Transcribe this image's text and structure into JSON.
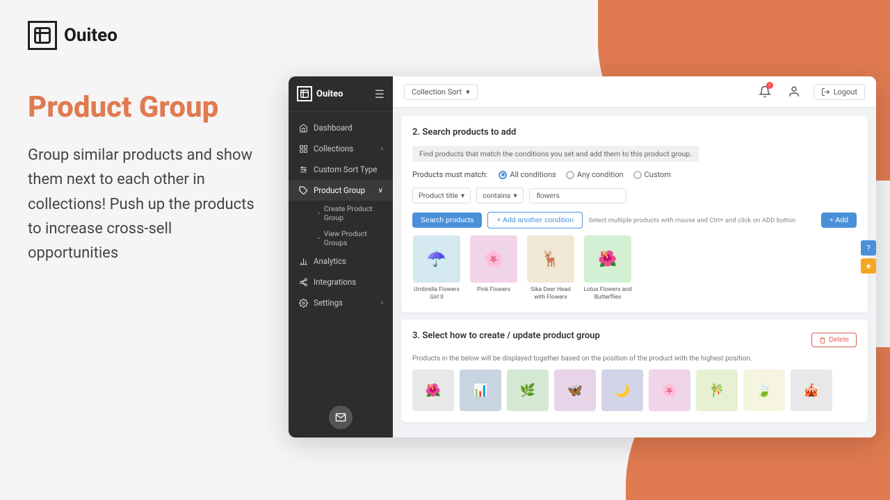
{
  "app": {
    "logo_text": "Ouiteo",
    "logo_icon": "bracket-icon"
  },
  "left_panel": {
    "title": "Product Group",
    "description": "Group similar products and show them next to each other in collections! Push up the products to increase cross-sell opportunities"
  },
  "sidebar": {
    "logo_text": "Ouiteo",
    "nav_items": [
      {
        "id": "dashboard",
        "label": "Dashboard",
        "icon": "home-icon",
        "active": false,
        "has_arrow": false
      },
      {
        "id": "collections",
        "label": "Collections",
        "icon": "grid-icon",
        "active": false,
        "has_arrow": true
      },
      {
        "id": "custom-sort-type",
        "label": "Custom Sort Type",
        "icon": "sliders-icon",
        "active": false,
        "has_arrow": false
      },
      {
        "id": "product-group",
        "label": "Product Group",
        "icon": "tag-icon",
        "active": true,
        "has_arrow": true
      }
    ],
    "sub_items": [
      {
        "label": "Create Product Group",
        "active": false
      },
      {
        "label": "View Product Groups",
        "active": false
      }
    ],
    "bottom_items": [
      {
        "id": "analytics",
        "label": "Analytics",
        "icon": "chart-icon",
        "active": false
      },
      {
        "id": "integrations",
        "label": "Integrations",
        "icon": "plug-icon",
        "active": false
      },
      {
        "id": "settings",
        "label": "Settings",
        "icon": "settings-icon",
        "active": false,
        "has_arrow": true
      }
    ]
  },
  "topbar": {
    "collection_sort_label": "Collection Sort",
    "dropdown_arrow": "▾",
    "notifications_badge": "1",
    "logout_label": "Logout"
  },
  "section2": {
    "title": "2. Search products to add",
    "hint": "Find products that match the conditions you set and add them to this product group.",
    "products_must_match_label": "Products must match:",
    "match_options": [
      "All conditions",
      "Any condition",
      "Custom"
    ],
    "active_match": "All conditions",
    "condition_field": "Product title",
    "condition_operator": "contains",
    "condition_value": "flowers",
    "search_btn": "Search products",
    "add_condition_btn": "+ Add another condition",
    "select_hint": "Select multiple products with mouse and Ctrl+ and click on ADD button",
    "add_btn": "+ Add",
    "products": [
      {
        "name": "Umbrella Flowers Girl II",
        "emoji": "☂️"
      },
      {
        "name": "Pink Flowers",
        "emoji": "🌸"
      },
      {
        "name": "Sika Deer Head with Flowers",
        "emoji": "🦌"
      },
      {
        "name": "Lotus Flowers and Butterflies",
        "emoji": "🌺"
      }
    ]
  },
  "section3": {
    "title": "3. Select how to create / update product group",
    "description": "Products in the below will be displayed together based on the position of the product with the highest position.",
    "delete_btn": "Delete",
    "products": [
      "🌺",
      "📊",
      "🌿",
      "🦋",
      "🌙",
      "🌸",
      "🎋",
      "🍃"
    ]
  },
  "helpers": {
    "question": "?",
    "star": "★"
  }
}
